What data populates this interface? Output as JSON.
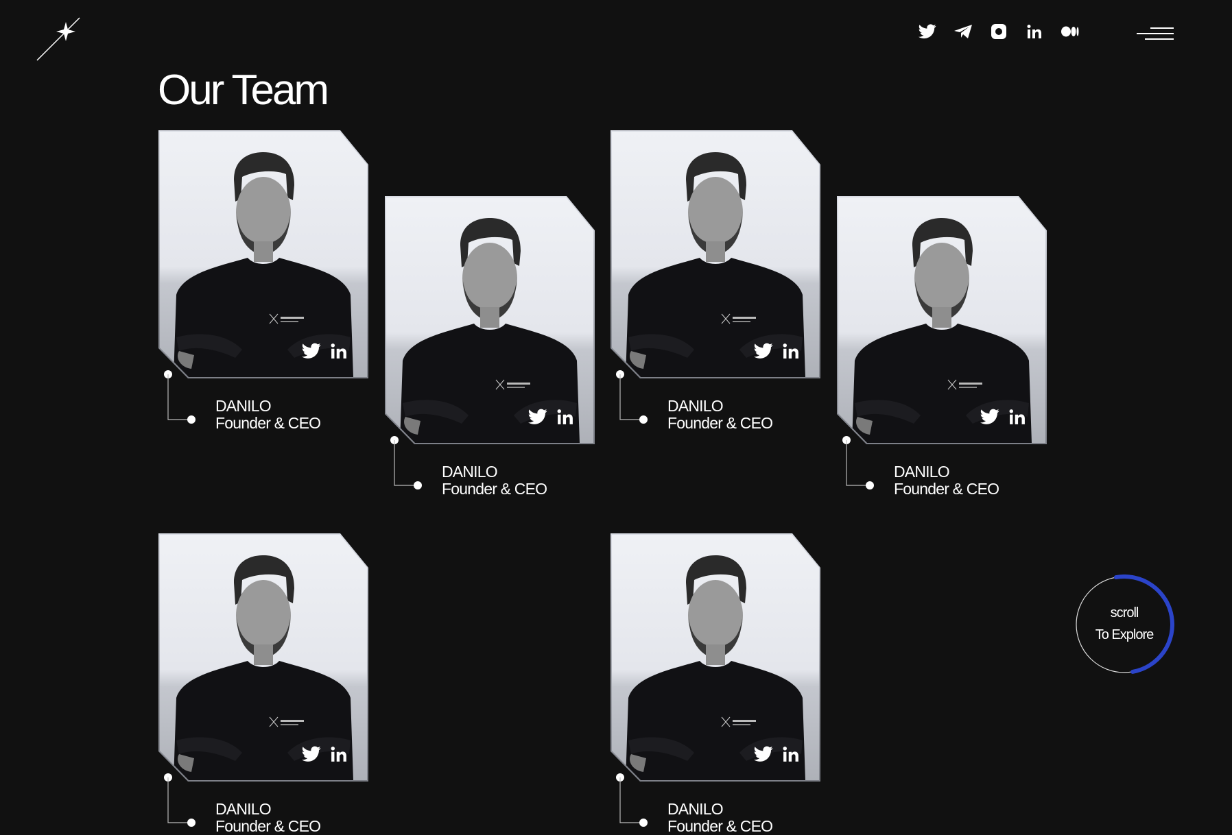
{
  "header": {
    "logo": "x-star-logo",
    "social_links": [
      {
        "icon": "twitter-icon"
      },
      {
        "icon": "telegram-icon"
      },
      {
        "icon": "instagram-icon"
      },
      {
        "icon": "linkedin-icon"
      },
      {
        "icon": "medium-icon"
      }
    ],
    "menu": "hamburger-menu-icon"
  },
  "page": {
    "title": "Our Team"
  },
  "team": [
    {
      "name": "DANILO",
      "role": "Founder & CEO"
    },
    {
      "name": "DANILO",
      "role": "Founder & CEO"
    },
    {
      "name": "DANILO",
      "role": "Founder & CEO"
    },
    {
      "name": "DANILO",
      "role": "Founder & CEO"
    },
    {
      "name": "DANILO",
      "role": "Founder & CEO"
    },
    {
      "name": "DANILO",
      "role": "Founder & CEO"
    }
  ],
  "scroll_badge": {
    "line1": "scroll",
    "line2": "To Explore",
    "accent_color": "#2b44c9"
  },
  "colors": {
    "background": "#111111",
    "text": "#ffffff"
  }
}
